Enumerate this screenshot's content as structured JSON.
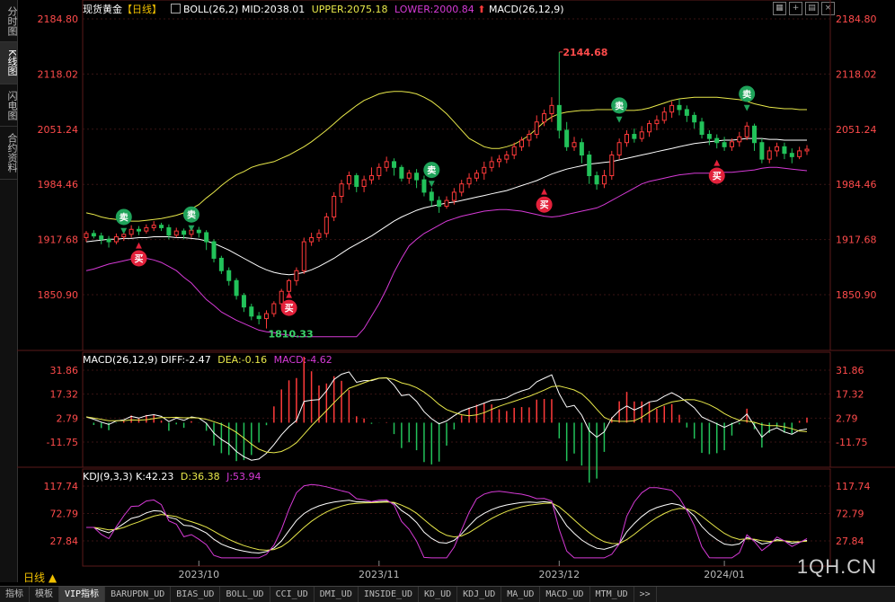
{
  "sidebar": [
    {
      "label": "分时图",
      "active": false
    },
    {
      "label": "K线图",
      "active": true
    },
    {
      "label": "闪电图",
      "active": false
    },
    {
      "label": "合约资料",
      "active": false
    }
  ],
  "header": {
    "symbol": "现货黄金",
    "period_tag": "【日线】",
    "boll": "BOLL(26,2)",
    "mid": "MID:2038.01",
    "upper": "UPPER:2075.18",
    "lower": "LOWER:2000.84",
    "macd_tag": "MACD(26,12,9)"
  },
  "macd_header": {
    "name": "MACD(26,12,9)",
    "diff": "DIFF:-2.47",
    "dea": "DEA:-0.16",
    "macd": "MACD:-4.62"
  },
  "kdj_header": {
    "name": "KDJ(9,3,3)",
    "k": "K:42.23",
    "d": "D:36.38",
    "j": "J:53.94"
  },
  "price_axis": [
    "2184.80",
    "2118.02",
    "2051.24",
    "1984.46",
    "1917.68",
    "1850.90"
  ],
  "macd_axis": [
    "31.86",
    "17.32",
    "2.79",
    "-11.75"
  ],
  "kdj_axis": [
    "117.74",
    "72.79",
    "27.84"
  ],
  "date_axis": [
    "2023/10",
    "2023/11",
    "2023/12",
    "2024/01"
  ],
  "annotations": {
    "high": "2144.68",
    "low": "1810.33",
    "buy": "买",
    "sell": "卖"
  },
  "period_button": "日线 ▲",
  "watermark": "1QH.CN",
  "bottom_tabs": [
    "指标",
    "模板",
    "VIP指标",
    "BARUPDN_UD",
    "BIAS_UD",
    "BOLL_UD",
    "CCI_UD",
    "DMI_UD",
    "INSIDE_UD",
    "KD_UD",
    "KDJ_UD",
    "MA_UD",
    "MACD_UD",
    "MTM_UD",
    ">>"
  ],
  "active_bottom_tab": "VIP指标",
  "colors": {
    "up": "#ff3a3a",
    "down": "#22c25a",
    "mid": "#ffffff",
    "upper": "#e8e84a",
    "lower": "#d63ad6",
    "axis": "#ff4b4b",
    "grid": "#3a1515"
  },
  "chart_data": {
    "type": "candlestick",
    "title": "现货黄金【日线】",
    "ylim": [
      1810,
      2200
    ],
    "candles": [
      [
        1920,
        1925,
        1915,
        1928
      ],
      [
        1925,
        1922,
        1919,
        1929
      ],
      [
        1922,
        1918,
        1912,
        1926
      ],
      [
        1918,
        1915,
        1908,
        1922
      ],
      [
        1915,
        1921,
        1912,
        1925
      ],
      [
        1921,
        1924,
        1916,
        1930
      ],
      [
        1924,
        1930,
        1920,
        1935
      ],
      [
        1930,
        1928,
        1923,
        1934
      ],
      [
        1928,
        1932,
        1925,
        1936
      ],
      [
        1932,
        1935,
        1928,
        1940
      ],
      [
        1935,
        1932,
        1928,
        1938
      ],
      [
        1932,
        1923,
        1918,
        1936
      ],
      [
        1923,
        1928,
        1920,
        1932
      ],
      [
        1928,
        1924,
        1918,
        1931
      ],
      [
        1924,
        1929,
        1920,
        1932
      ],
      [
        1929,
        1926,
        1920,
        1933
      ],
      [
        1926,
        1915,
        1905,
        1929
      ],
      [
        1915,
        1895,
        1890,
        1918
      ],
      [
        1895,
        1880,
        1876,
        1898
      ],
      [
        1880,
        1868,
        1862,
        1884
      ],
      [
        1868,
        1850,
        1845,
        1871
      ],
      [
        1850,
        1836,
        1830,
        1853
      ],
      [
        1836,
        1825,
        1820,
        1840
      ],
      [
        1825,
        1822,
        1815,
        1830
      ],
      [
        1822,
        1828,
        1810,
        1832
      ],
      [
        1828,
        1840,
        1824,
        1843
      ],
      [
        1840,
        1855,
        1836,
        1858
      ],
      [
        1855,
        1868,
        1850,
        1870
      ],
      [
        1868,
        1880,
        1862,
        1884
      ],
      [
        1880,
        1915,
        1876,
        1920
      ],
      [
        1915,
        1920,
        1910,
        1926
      ],
      [
        1920,
        1925,
        1915,
        1930
      ],
      [
        1925,
        1945,
        1920,
        1950
      ],
      [
        1945,
        1970,
        1940,
        1975
      ],
      [
        1970,
        1985,
        1962,
        1990
      ],
      [
        1985,
        1995,
        1978,
        2000
      ],
      [
        1995,
        1982,
        1975,
        1998
      ],
      [
        1982,
        1990,
        1975,
        1995
      ],
      [
        1990,
        1995,
        1985,
        2005
      ],
      [
        1995,
        2005,
        1990,
        2010
      ],
      [
        2005,
        2012,
        2000,
        2018
      ],
      [
        2012,
        2005,
        1995,
        2016
      ],
      [
        2005,
        1992,
        1988,
        2008
      ],
      [
        1992,
        1998,
        1985,
        2002
      ],
      [
        1998,
        1990,
        1980,
        2003
      ],
      [
        1990,
        1975,
        1970,
        1995
      ],
      [
        1975,
        1965,
        1958,
        1980
      ],
      [
        1965,
        1958,
        1950,
        1970
      ],
      [
        1958,
        1965,
        1955,
        1970
      ],
      [
        1965,
        1975,
        1960,
        1980
      ],
      [
        1975,
        1985,
        1970,
        1990
      ],
      [
        1985,
        1992,
        1980,
        1998
      ],
      [
        1992,
        1998,
        1988,
        2002
      ],
      [
        1998,
        2005,
        1990,
        2012
      ],
      [
        2005,
        2012,
        2000,
        2018
      ],
      [
        2012,
        2015,
        2005,
        2020
      ],
      [
        2015,
        2020,
        2010,
        2025
      ],
      [
        2020,
        2030,
        2015,
        2035
      ],
      [
        2030,
        2038,
        2025,
        2042
      ],
      [
        2038,
        2045,
        2030,
        2050
      ],
      [
        2045,
        2060,
        2040,
        2068
      ],
      [
        2060,
        2070,
        2055,
        2075
      ],
      [
        2070,
        2080,
        2060,
        2090
      ],
      [
        2080,
        2050,
        2040,
        2144.68
      ],
      [
        2050,
        2030,
        2025,
        2060
      ],
      [
        2030,
        2035,
        2025,
        2042
      ],
      [
        2035,
        2020,
        2010,
        2040
      ],
      [
        2020,
        1995,
        1985,
        2025
      ],
      [
        1995,
        1985,
        1978,
        2000
      ],
      [
        1985,
        1995,
        1980,
        2002
      ],
      [
        1995,
        2020,
        1990,
        2025
      ],
      [
        2020,
        2035,
        2015,
        2040
      ],
      [
        2035,
        2045,
        2030,
        2050
      ],
      [
        2045,
        2040,
        2035,
        2052
      ],
      [
        2040,
        2048,
        2036,
        2055
      ],
      [
        2048,
        2058,
        2042,
        2062
      ],
      [
        2058,
        2062,
        2050,
        2068
      ],
      [
        2062,
        2072,
        2058,
        2078
      ],
      [
        2072,
        2080,
        2065,
        2085
      ],
      [
        2080,
        2075,
        2068,
        2088
      ],
      [
        2075,
        2068,
        2060,
        2080
      ],
      [
        2068,
        2060,
        2052,
        2072
      ],
      [
        2060,
        2045,
        2040,
        2065
      ],
      [
        2045,
        2040,
        2032,
        2050
      ],
      [
        2040,
        2035,
        2028,
        2045
      ],
      [
        2035,
        2030,
        2025,
        2042
      ],
      [
        2030,
        2036,
        2025,
        2040
      ],
      [
        2036,
        2042,
        2030,
        2048
      ],
      [
        2042,
        2055,
        2038,
        2060
      ],
      [
        2055,
        2035,
        2025,
        2058
      ],
      [
        2035,
        2015,
        2010,
        2040
      ],
      [
        2015,
        2025,
        2010,
        2030
      ],
      [
        2025,
        2030,
        2018,
        2035
      ],
      [
        2030,
        2022,
        2015,
        2035
      ],
      [
        2022,
        2018,
        2010,
        2028
      ],
      [
        2018,
        2025,
        2015,
        2030
      ],
      [
        2025,
        2027,
        2020,
        2032
      ]
    ],
    "boll_mid": [
      1915,
      1916,
      1917,
      1918,
      1918,
      1919,
      1919,
      1920,
      1920,
      1921,
      1921,
      1921,
      1920,
      1920,
      1919,
      1918,
      1916,
      1913,
      1909,
      1905,
      1900,
      1895,
      1890,
      1885,
      1881,
      1878,
      1876,
      1875,
      1876,
      1878,
      1881,
      1885,
      1890,
      1895,
      1901,
      1907,
      1912,
      1917,
      1922,
      1928,
      1934,
      1940,
      1945,
      1949,
      1953,
      1956,
      1958,
      1960,
      1962,
      1963,
      1965,
      1967,
      1969,
      1971,
      1973,
      1975,
      1977,
      1980,
      1983,
      1986,
      1989,
      1993,
      1997,
      2000,
      2003,
      2005,
      2007,
      2009,
      2010,
      2011,
      2012,
      2014,
      2016,
      2018,
      2020,
      2022,
      2024,
      2026,
      2028,
      2030,
      2032,
      2034,
      2035,
      2036,
      2037,
      2038,
      2038,
      2039,
      2040,
      2040,
      2040,
      2039,
      2039,
      2038,
      2038,
      2038,
      2038
    ],
    "boll_upper": [
      1950,
      1948,
      1945,
      1943,
      1942,
      1941,
      1940,
      1940,
      1941,
      1942,
      1943,
      1945,
      1947,
      1950,
      1955,
      1960,
      1968,
      1975,
      1983,
      1990,
      1996,
      2000,
      2005,
      2008,
      2010,
      2012,
      2016,
      2020,
      2025,
      2030,
      2036,
      2043,
      2050,
      2058,
      2066,
      2073,
      2080,
      2086,
      2090,
      2094,
      2096,
      2097,
      2097,
      2096,
      2094,
      2090,
      2085,
      2078,
      2070,
      2060,
      2050,
      2040,
      2035,
      2030,
      2028,
      2028,
      2030,
      2033,
      2038,
      2044,
      2052,
      2060,
      2066,
      2070,
      2072,
      2073,
      2074,
      2074,
      2075,
      2075,
      2075,
      2075,
      2074,
      2074,
      2075,
      2077,
      2080,
      2083,
      2086,
      2088,
      2089,
      2090,
      2090,
      2090,
      2090,
      2089,
      2088,
      2087,
      2085,
      2082,
      2080,
      2078,
      2077,
      2076,
      2076,
      2075,
      2075
    ],
    "boll_lower": [
      1880,
      1882,
      1885,
      1888,
      1890,
      1892,
      1894,
      1896,
      1895,
      1893,
      1890,
      1885,
      1880,
      1872,
      1865,
      1855,
      1845,
      1838,
      1830,
      1825,
      1820,
      1816,
      1812,
      1808,
      1806,
      1805,
      1803,
      1802,
      1800,
      1800,
      1800,
      1800,
      1800,
      1800,
      1800,
      1800,
      1800,
      1810,
      1825,
      1840,
      1858,
      1878,
      1895,
      1910,
      1918,
      1925,
      1930,
      1935,
      1940,
      1943,
      1946,
      1948,
      1950,
      1952,
      1953,
      1954,
      1954,
      1953,
      1952,
      1950,
      1948,
      1946,
      1945,
      1946,
      1948,
      1950,
      1952,
      1954,
      1956,
      1960,
      1965,
      1970,
      1975,
      1980,
      1985,
      1988,
      1990,
      1992,
      1994,
      1996,
      1997,
      1998,
      1998,
      1998,
      1998,
      1999,
      1999,
      2000,
      2001,
      2002,
      2004,
      2005,
      2005,
      2004,
      2003,
      2002,
      2001
    ]
  }
}
